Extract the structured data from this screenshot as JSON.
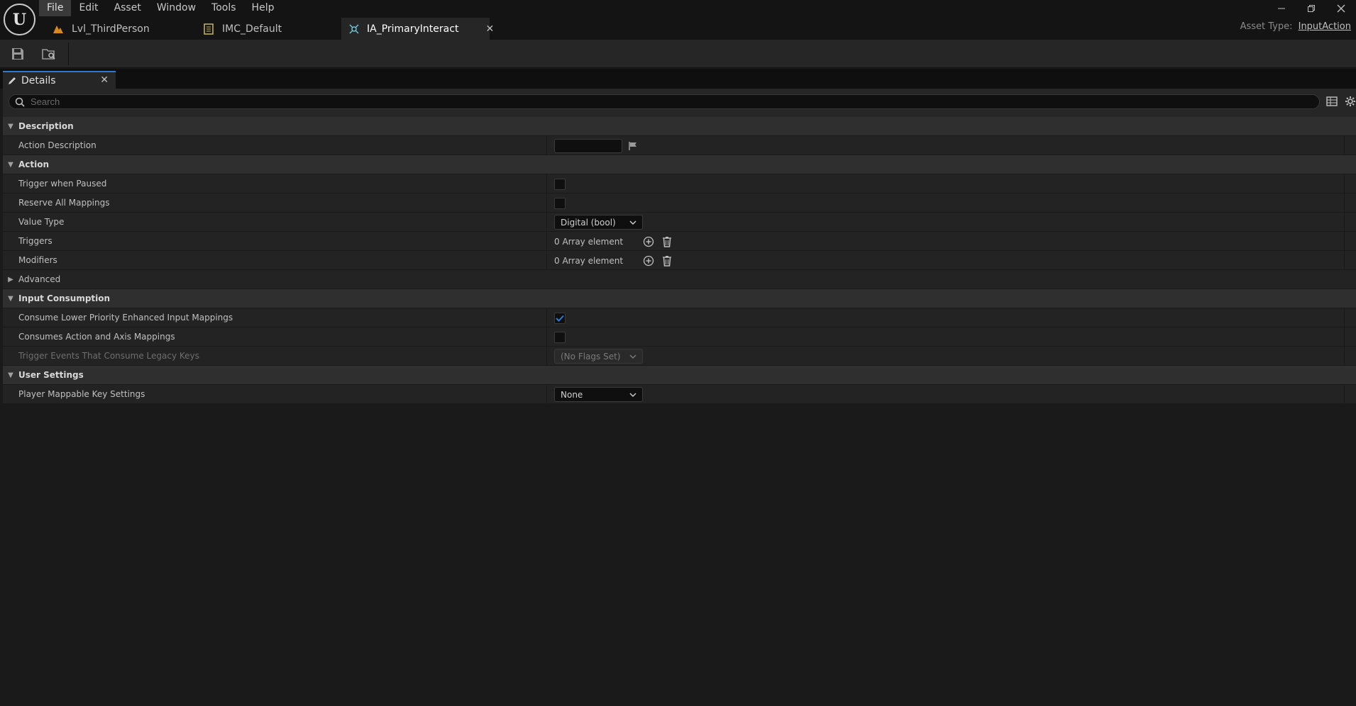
{
  "menu": [
    "File",
    "Edit",
    "Asset",
    "Window",
    "Tools",
    "Help"
  ],
  "tabs": [
    {
      "label": "Lvl_ThirdPerson"
    },
    {
      "label": "IMC_Default"
    },
    {
      "label": "IA_PrimaryInteract"
    }
  ],
  "asset_type": {
    "label": "Asset Type:",
    "value": "InputAction"
  },
  "details": {
    "tab_label": "Details",
    "search_placeholder": "Search"
  },
  "sections": {
    "description": {
      "title": "Description",
      "action_description": {
        "label": "Action Description",
        "value": ""
      }
    },
    "action": {
      "title": "Action",
      "trigger_when_paused": {
        "label": "Trigger when Paused",
        "checked": false
      },
      "reserve_all_mappings": {
        "label": "Reserve All Mappings",
        "checked": false
      },
      "value_type": {
        "label": "Value Type",
        "value": "Digital (bool)"
      },
      "triggers": {
        "label": "Triggers",
        "value": "0 Array element"
      },
      "modifiers": {
        "label": "Modifiers",
        "value": "0 Array element"
      },
      "advanced": {
        "label": "Advanced"
      }
    },
    "input_consumption": {
      "title": "Input Consumption",
      "consume_lower": {
        "label": "Consume Lower Priority Enhanced Input Mappings",
        "checked": true
      },
      "consumes_action_axis": {
        "label": "Consumes Action and Axis Mappings",
        "checked": false
      },
      "trigger_events": {
        "label": "Trigger Events That Consume Legacy Keys",
        "value": "(No Flags Set)"
      }
    },
    "user_settings": {
      "title": "User Settings",
      "player_mappable": {
        "label": "Player Mappable Key Settings",
        "value": "None"
      }
    }
  },
  "colors": {
    "accent": "#2a7bd4",
    "background": "#1a1a1a",
    "panel": "#262626",
    "category": "#2f2f2f"
  }
}
